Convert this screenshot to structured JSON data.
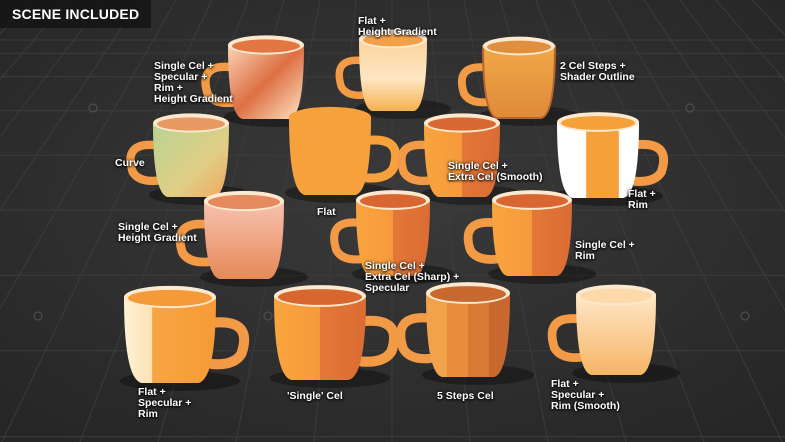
{
  "badge": "SCENE INCLUDED",
  "colors": {
    "background": "#2e2e2e",
    "grid": "#3c3c3c",
    "cup_orange": "#f6a13c",
    "cup_dark": "#e07a32",
    "cup_light": "#fde3b8",
    "cup_pink": "#f2b7a6",
    "cup_green": "#c9d38a"
  },
  "labels": {
    "l01": [
      "Flat +",
      "Height Gradient"
    ],
    "l02": [
      "Single Cel +",
      "Specular +",
      "Rim +",
      "Height Gradient"
    ],
    "l03": [
      "2 Cel Steps +",
      "Shader Outline"
    ],
    "l04": [
      "Curve"
    ],
    "l05": [
      "Single Cel +",
      "Extra Cel (Smooth)"
    ],
    "l06": [
      "Flat +",
      "Rim"
    ],
    "l07": [
      "Flat"
    ],
    "l08": [
      "Single Cel +",
      "Height Gradient"
    ],
    "l09": [
      "Single Cel +",
      "Rim"
    ],
    "l10": [
      "Single Cel +",
      "Extra Cel (Sharp) +",
      "Specular"
    ],
    "l11": [
      "Flat +",
      "Specular +",
      "Rim"
    ],
    "l12": [
      "'Single' Cel"
    ],
    "l13": [
      "5 Steps Cel"
    ],
    "l14": [
      "Flat +",
      "Specular +",
      "Rim (Smooth)"
    ]
  },
  "cups": [
    {
      "name": "cup-flat-height-gradient",
      "style": "gradient-light"
    },
    {
      "name": "cup-single-cel-specular-rim-height-gradient",
      "style": "pink-rim"
    },
    {
      "name": "cup-2-cel-steps-shader-outline",
      "style": "outline"
    },
    {
      "name": "cup-curve",
      "style": "green"
    },
    {
      "name": "cup-flat",
      "style": "flat"
    },
    {
      "name": "cup-single-cel-extra-cel-smooth",
      "style": "cel"
    },
    {
      "name": "cup-flat-rim",
      "style": "white-rim"
    },
    {
      "name": "cup-single-cel-height-gradient",
      "style": "pink-gradient"
    },
    {
      "name": "cup-single-cel-extra-cel-sharp-specular",
      "style": "cel"
    },
    {
      "name": "cup-single-cel-rim",
      "style": "cel"
    },
    {
      "name": "cup-flat-specular-rim",
      "style": "cream"
    },
    {
      "name": "cup-single-cel",
      "style": "cel-light"
    },
    {
      "name": "cup-5-steps-cel",
      "style": "steps"
    },
    {
      "name": "cup-flat-specular-rim-smooth",
      "style": "soft-cream"
    }
  ]
}
